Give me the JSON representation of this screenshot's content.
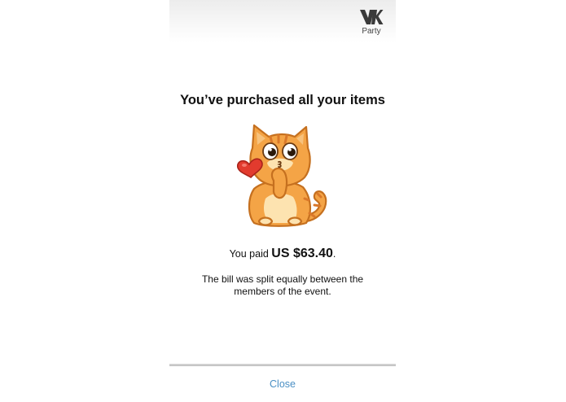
{
  "header": {
    "logo_icon": "vk-logo-icon",
    "logo_caption": "Party"
  },
  "main": {
    "title": "You’ve purchased all your items",
    "sticker": "cat-sticker",
    "paid_prefix": "You paid ",
    "paid_amount": "US $63.40",
    "paid_suffix": ".",
    "note": "The bill was split equally between the members of the event."
  },
  "footer": {
    "close_label": "Close"
  },
  "colors": {
    "link": "#4a8fc4",
    "cat_fur": "#f4a446",
    "cat_outline": "#c5701f",
    "heart": "#e23b2e"
  }
}
